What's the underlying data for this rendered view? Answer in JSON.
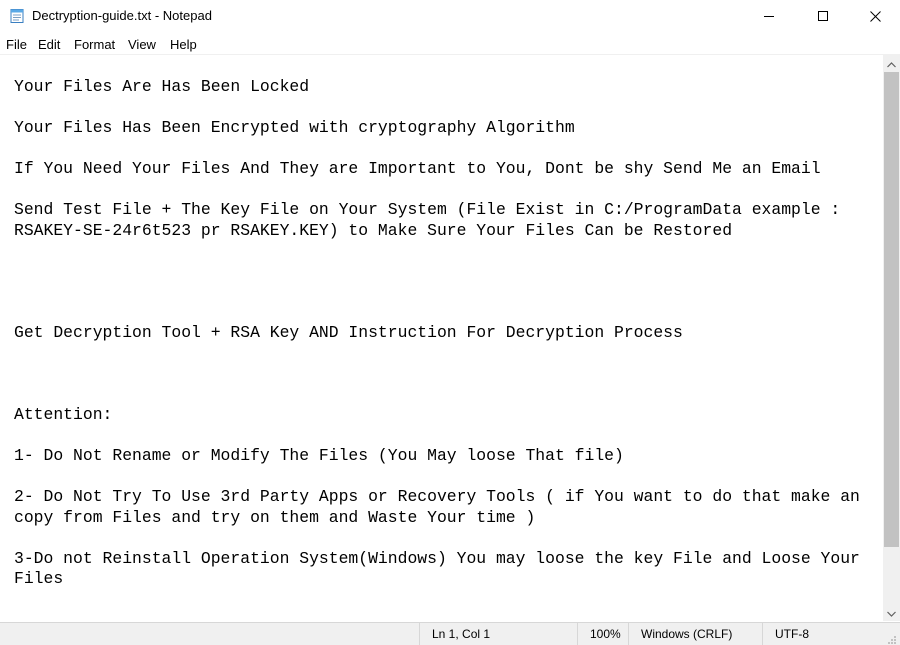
{
  "window": {
    "title": "Dectryption-guide.txt - Notepad",
    "icon": "notepad-icon",
    "controls": [
      "minimize-icon",
      "maximize-icon",
      "close-icon"
    ]
  },
  "menu": {
    "file": "File",
    "edit": "Edit",
    "format": "Format",
    "view": "View",
    "help": "Help"
  },
  "document": {
    "content": "Your Files Are Has Been Locked\n\nYour Files Has Been Encrypted with cryptography Algorithm\n\nIf You Need Your Files And They are Important to You, Dont be shy Send Me an Email\n\nSend Test File + The Key File on Your System (File Exist in C:/ProgramData example :\nRSAKEY-SE-24r6t523 pr RSAKEY.KEY) to Make Sure Your Files Can be Restored\n\n\n\n\nGet Decryption Tool + RSA Key AND Instruction For Decryption Process\n\n\n\nAttention:\n\n1- Do Not Rename or Modify The Files (You May loose That file)\n\n2- Do Not Try To Use 3rd Party Apps or Recovery Tools ( if You want to do that make an\ncopy from Files and try on them and Waste Your time )\n\n3-Do not Reinstall Operation System(Windows) You may loose the key File and Loose Your\nFiles"
  },
  "scrollbar": {
    "up_icon": "chevron-up-icon",
    "down_icon": "chevron-down-icon"
  },
  "status": {
    "position": "Ln 1, Col 1",
    "zoom": "100%",
    "line_ending": "Windows (CRLF)",
    "encoding": "UTF-8"
  },
  "colors": {
    "window_bg": "#ffffff",
    "status_bg": "#f0f0f0",
    "scroll_thumb": "#c2c2c2",
    "text": "#000000"
  }
}
